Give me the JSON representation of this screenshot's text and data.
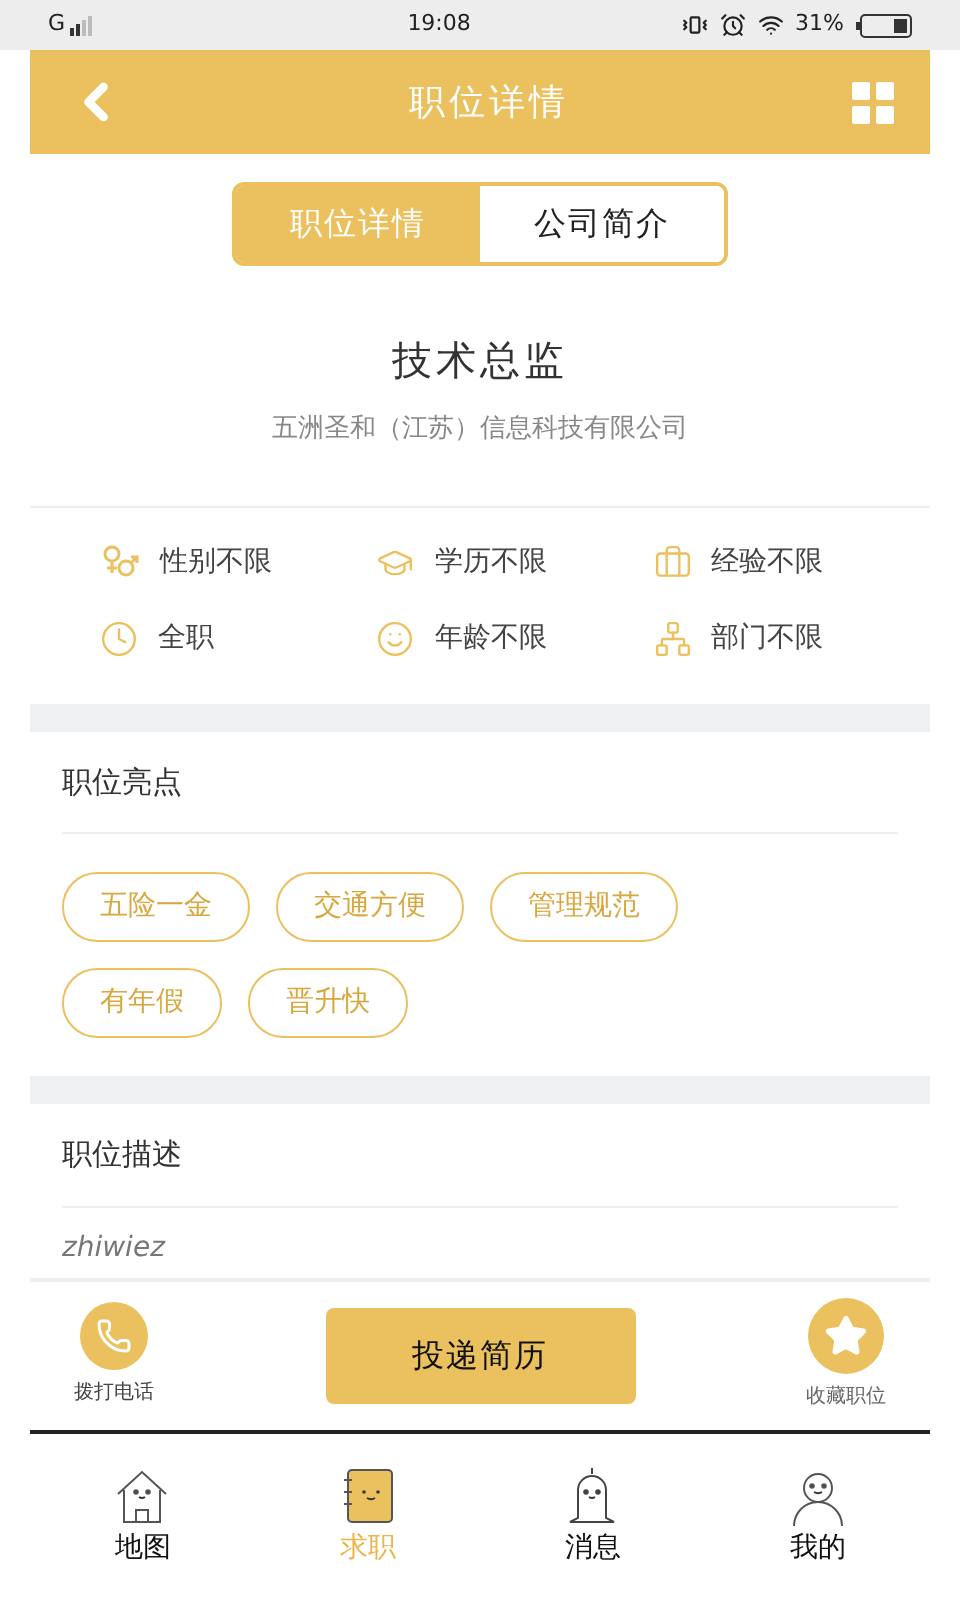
{
  "status_bar": {
    "network": "G",
    "time": "19:08",
    "battery": "31%"
  },
  "header": {
    "title": "职位详情"
  },
  "tabs": [
    {
      "label": "职位详情",
      "selected": true
    },
    {
      "label": "公司简介",
      "selected": false
    }
  ],
  "job": {
    "title": "技术总监",
    "company": "五洲圣和（江苏）信息科技有限公司"
  },
  "requirements": [
    {
      "kind": "gender",
      "label": "性别不限"
    },
    {
      "kind": "education",
      "label": "学历不限"
    },
    {
      "kind": "experience",
      "label": "经验不限"
    },
    {
      "kind": "time",
      "label": "全职"
    },
    {
      "kind": "age",
      "label": "年龄不限"
    },
    {
      "kind": "department",
      "label": "部门不限"
    }
  ],
  "highlights": {
    "title": "职位亮点",
    "tags": [
      "五险一金",
      "交通方便",
      "管理规范",
      "有年假",
      "晋升快"
    ]
  },
  "description": {
    "title": "职位描述",
    "text": "zhiwiez"
  },
  "actions": {
    "call": "拨打电话",
    "apply": "投递简历",
    "favorite": "收藏职位"
  },
  "nav": [
    {
      "kind": "map",
      "label": "地图",
      "selected": false
    },
    {
      "kind": "jobs",
      "label": "求职",
      "selected": true
    },
    {
      "kind": "messages",
      "label": "消息",
      "selected": false
    },
    {
      "kind": "me",
      "label": "我的",
      "selected": false
    }
  ]
}
